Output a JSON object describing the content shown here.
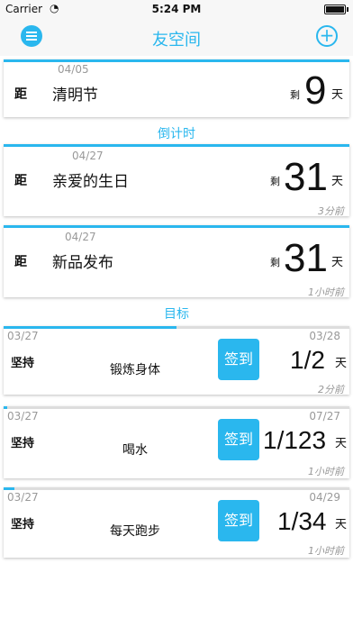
{
  "status": {
    "carrier": "Carrier",
    "time": "5:24 PM"
  },
  "nav": {
    "title": "友空间"
  },
  "countdowns": [
    {
      "date": "04/05",
      "ju": "距",
      "title": "清明节",
      "remain": "剩",
      "days": "9",
      "unit": "天",
      "ago": ""
    },
    {
      "date": "04/27",
      "ju": "距",
      "title": "亲爱的生日",
      "remain": "剩",
      "days": "31",
      "unit": "天",
      "ago": "3分前"
    },
    {
      "date": "04/27",
      "ju": "距",
      "title": "新品发布",
      "remain": "剩",
      "days": "31",
      "unit": "天",
      "ago": "1小时前"
    }
  ],
  "sections": {
    "countdown": "倒计时",
    "goals": "目标"
  },
  "goals": [
    {
      "start": "03/27",
      "end": "03/28",
      "label": "坚持",
      "title": "锻炼身体",
      "button": "签到",
      "ratio": "1/2",
      "unit": "天",
      "ago": "2分前",
      "progress": 0.5
    },
    {
      "start": "03/27",
      "end": "07/27",
      "label": "坚持",
      "title": "喝水",
      "button": "签到",
      "ratio": "1/123",
      "unit": "天",
      "ago": "1小时前",
      "progress": 0.008
    },
    {
      "start": "03/27",
      "end": "04/29",
      "label": "坚持",
      "title": "每天跑步",
      "button": "签到",
      "ratio": "1/34",
      "unit": "天",
      "ago": "1小时前",
      "progress": 0.03
    }
  ],
  "colors": {
    "accent": "#2ab7ee"
  },
  "icons": {
    "menu": "menu-icon",
    "add": "add-icon",
    "wifi": "wifi-icon",
    "battery": "battery-icon"
  }
}
